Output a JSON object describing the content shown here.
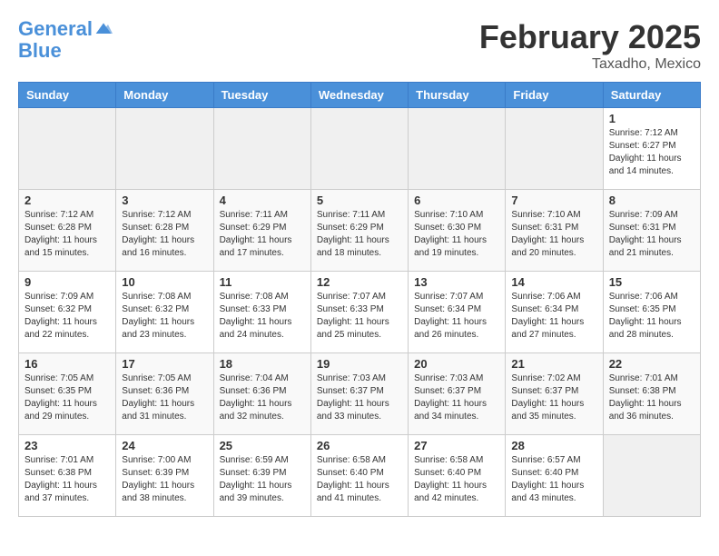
{
  "header": {
    "logo_line1": "General",
    "logo_line2": "Blue",
    "month_title": "February 2025",
    "location": "Taxadho, Mexico"
  },
  "weekdays": [
    "Sunday",
    "Monday",
    "Tuesday",
    "Wednesday",
    "Thursday",
    "Friday",
    "Saturday"
  ],
  "weeks": [
    [
      {
        "day": "",
        "info": ""
      },
      {
        "day": "",
        "info": ""
      },
      {
        "day": "",
        "info": ""
      },
      {
        "day": "",
        "info": ""
      },
      {
        "day": "",
        "info": ""
      },
      {
        "day": "",
        "info": ""
      },
      {
        "day": "1",
        "info": "Sunrise: 7:12 AM\nSunset: 6:27 PM\nDaylight: 11 hours\nand 14 minutes."
      }
    ],
    [
      {
        "day": "2",
        "info": "Sunrise: 7:12 AM\nSunset: 6:28 PM\nDaylight: 11 hours\nand 15 minutes."
      },
      {
        "day": "3",
        "info": "Sunrise: 7:12 AM\nSunset: 6:28 PM\nDaylight: 11 hours\nand 16 minutes."
      },
      {
        "day": "4",
        "info": "Sunrise: 7:11 AM\nSunset: 6:29 PM\nDaylight: 11 hours\nand 17 minutes."
      },
      {
        "day": "5",
        "info": "Sunrise: 7:11 AM\nSunset: 6:29 PM\nDaylight: 11 hours\nand 18 minutes."
      },
      {
        "day": "6",
        "info": "Sunrise: 7:10 AM\nSunset: 6:30 PM\nDaylight: 11 hours\nand 19 minutes."
      },
      {
        "day": "7",
        "info": "Sunrise: 7:10 AM\nSunset: 6:31 PM\nDaylight: 11 hours\nand 20 minutes."
      },
      {
        "day": "8",
        "info": "Sunrise: 7:09 AM\nSunset: 6:31 PM\nDaylight: 11 hours\nand 21 minutes."
      }
    ],
    [
      {
        "day": "9",
        "info": "Sunrise: 7:09 AM\nSunset: 6:32 PM\nDaylight: 11 hours\nand 22 minutes."
      },
      {
        "day": "10",
        "info": "Sunrise: 7:08 AM\nSunset: 6:32 PM\nDaylight: 11 hours\nand 23 minutes."
      },
      {
        "day": "11",
        "info": "Sunrise: 7:08 AM\nSunset: 6:33 PM\nDaylight: 11 hours\nand 24 minutes."
      },
      {
        "day": "12",
        "info": "Sunrise: 7:07 AM\nSunset: 6:33 PM\nDaylight: 11 hours\nand 25 minutes."
      },
      {
        "day": "13",
        "info": "Sunrise: 7:07 AM\nSunset: 6:34 PM\nDaylight: 11 hours\nand 26 minutes."
      },
      {
        "day": "14",
        "info": "Sunrise: 7:06 AM\nSunset: 6:34 PM\nDaylight: 11 hours\nand 27 minutes."
      },
      {
        "day": "15",
        "info": "Sunrise: 7:06 AM\nSunset: 6:35 PM\nDaylight: 11 hours\nand 28 minutes."
      }
    ],
    [
      {
        "day": "16",
        "info": "Sunrise: 7:05 AM\nSunset: 6:35 PM\nDaylight: 11 hours\nand 29 minutes."
      },
      {
        "day": "17",
        "info": "Sunrise: 7:05 AM\nSunset: 6:36 PM\nDaylight: 11 hours\nand 31 minutes."
      },
      {
        "day": "18",
        "info": "Sunrise: 7:04 AM\nSunset: 6:36 PM\nDaylight: 11 hours\nand 32 minutes."
      },
      {
        "day": "19",
        "info": "Sunrise: 7:03 AM\nSunset: 6:37 PM\nDaylight: 11 hours\nand 33 minutes."
      },
      {
        "day": "20",
        "info": "Sunrise: 7:03 AM\nSunset: 6:37 PM\nDaylight: 11 hours\nand 34 minutes."
      },
      {
        "day": "21",
        "info": "Sunrise: 7:02 AM\nSunset: 6:37 PM\nDaylight: 11 hours\nand 35 minutes."
      },
      {
        "day": "22",
        "info": "Sunrise: 7:01 AM\nSunset: 6:38 PM\nDaylight: 11 hours\nand 36 minutes."
      }
    ],
    [
      {
        "day": "23",
        "info": "Sunrise: 7:01 AM\nSunset: 6:38 PM\nDaylight: 11 hours\nand 37 minutes."
      },
      {
        "day": "24",
        "info": "Sunrise: 7:00 AM\nSunset: 6:39 PM\nDaylight: 11 hours\nand 38 minutes."
      },
      {
        "day": "25",
        "info": "Sunrise: 6:59 AM\nSunset: 6:39 PM\nDaylight: 11 hours\nand 39 minutes."
      },
      {
        "day": "26",
        "info": "Sunrise: 6:58 AM\nSunset: 6:40 PM\nDaylight: 11 hours\nand 41 minutes."
      },
      {
        "day": "27",
        "info": "Sunrise: 6:58 AM\nSunset: 6:40 PM\nDaylight: 11 hours\nand 42 minutes."
      },
      {
        "day": "28",
        "info": "Sunrise: 6:57 AM\nSunset: 6:40 PM\nDaylight: 11 hours\nand 43 minutes."
      },
      {
        "day": "",
        "info": ""
      }
    ]
  ]
}
